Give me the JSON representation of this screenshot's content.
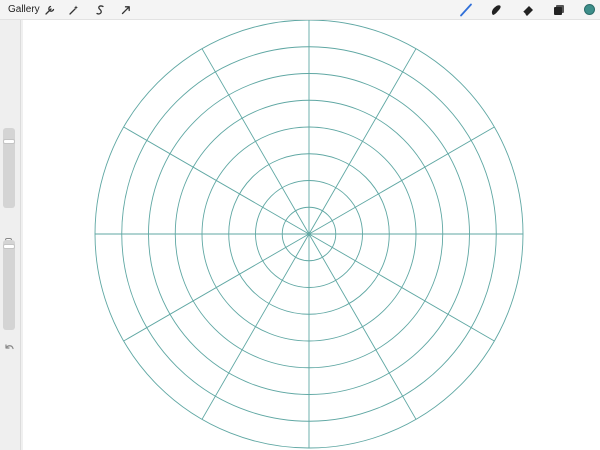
{
  "toolbar": {
    "gallery_label": "Gallery",
    "left_tools": [
      "wrench-icon",
      "magic-wand-icon",
      "selection-icon",
      "transform-arrow-icon"
    ],
    "right_tools": [
      "brush-icon",
      "smudge-icon",
      "eraser-icon",
      "layers-icon"
    ],
    "active_tool": "brush-icon",
    "active_color": "#3d8e8a"
  },
  "sidebar": {
    "brush_size_level": 0.15,
    "opacity_level": 0.05,
    "modify_button": "square-icon",
    "undo_icon": "undo-icon"
  },
  "canvas": {
    "background": "#ffffff",
    "guide_color": "#5fa7a3",
    "guide": {
      "type": "polar",
      "rings": 8,
      "spokes": 12
    }
  }
}
